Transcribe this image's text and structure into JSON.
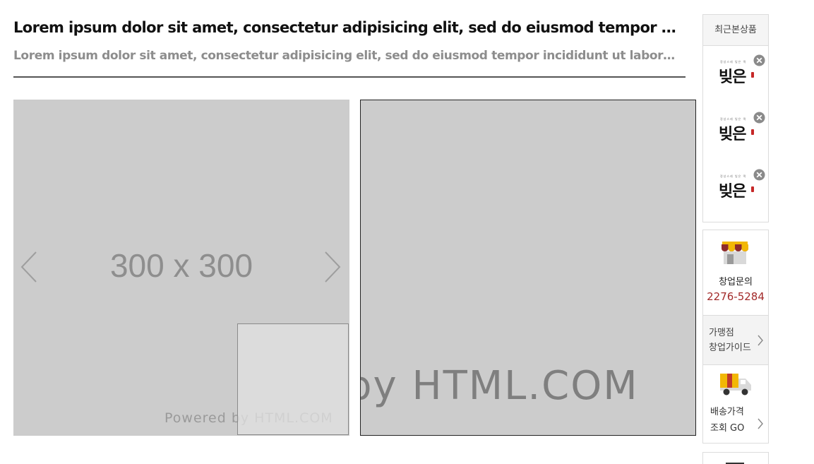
{
  "product": {
    "title": "Lorem ipsum dolor sit amet, consectetur adipisicing elit, sed do eiusmod tempor incididunt ut labore et dolore magna aliqua.",
    "subtitle": "Lorem ipsum dolor sit amet, consectetur adipisicing elit, sed do eiusmod tempor incididunt ut labore et dolore magna aliqua."
  },
  "gallery": {
    "placeholder_text": "300 x 300",
    "watermark": "Powered by HTML.COM",
    "prev_icon": "chevron-left-icon",
    "next_icon": "chevron-right-icon"
  },
  "zoom": {
    "watermark": "by HTML.COM"
  },
  "sidebar": {
    "recent": {
      "heading": "최근본상품",
      "items": [
        {
          "logo_small": "정성스레 빚은 떡",
          "logo_big": "빚은",
          "remove_icon": "close-circle-icon"
        },
        {
          "logo_small": "정성스레 빚은 떡",
          "logo_big": "빚은",
          "remove_icon": "close-circle-icon"
        },
        {
          "logo_small": "정성스레 빚은 떡",
          "logo_big": "빚은",
          "remove_icon": "close-circle-icon"
        }
      ]
    },
    "startup": {
      "icon": "storefront-icon",
      "label": "창업문의",
      "phone": "2276-5284"
    },
    "franchise_guide": {
      "line1": "가맹점",
      "line2": "창업가이드",
      "icon": "chevron-right-icon"
    },
    "shipping": {
      "icon": "delivery-truck-icon",
      "line1": "배송가격",
      "line2": "조회 GO",
      "arrow_icon": "chevron-right-icon"
    }
  },
  "colors": {
    "accent_red": "#a32b2b",
    "placeholder_gray": "#cccccc",
    "subtitle_gray": "#8d8d8d"
  }
}
